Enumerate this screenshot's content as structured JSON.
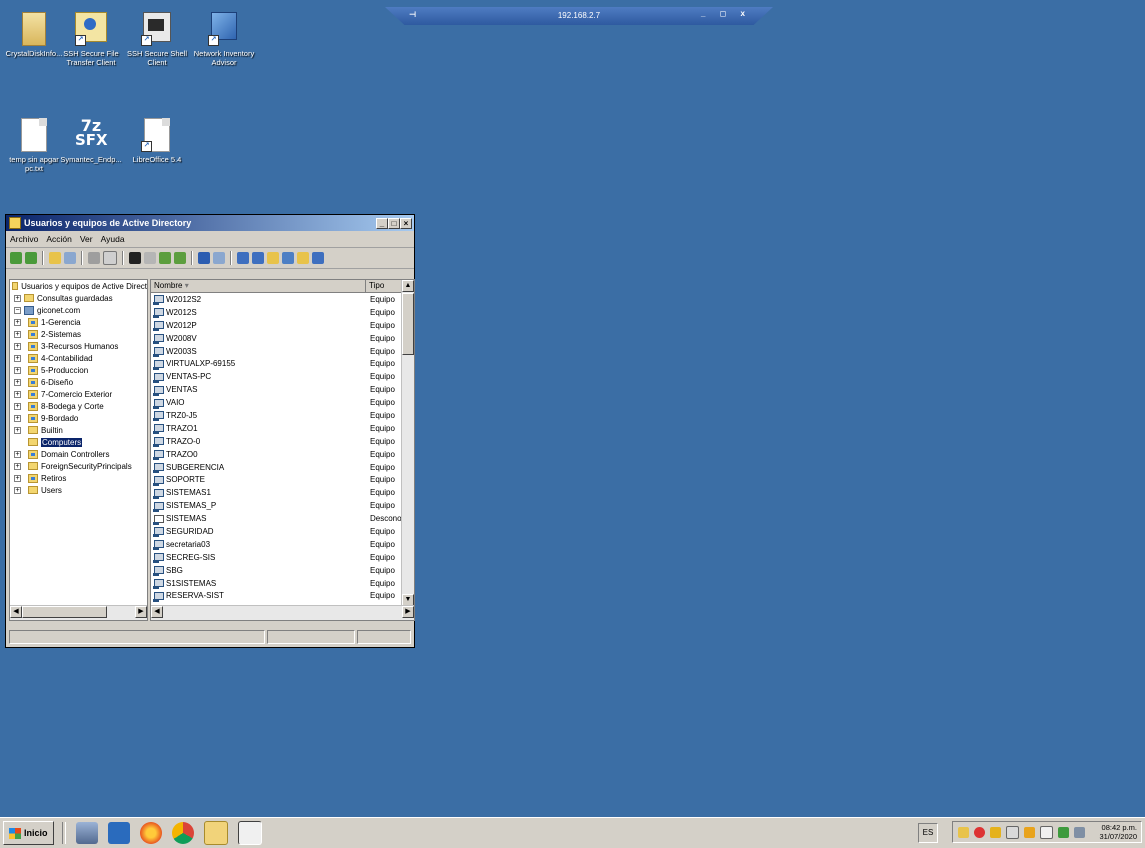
{
  "desktop": {
    "icons": [
      {
        "label": "CrystalDiskInfo..."
      },
      {
        "label": "SSH Secure File Transfer Client"
      },
      {
        "label": "SSH Secure Shell Client"
      },
      {
        "label": "Network Inventory Advisor"
      },
      {
        "label": "temp sin apgar pc.txt"
      },
      {
        "label": "Symantec_Endp..."
      },
      {
        "label": "LibreOffice 5.4"
      }
    ],
    "sfx_text": {
      "top": "7z",
      "bottom": "SFX"
    }
  },
  "rdp_bar": {
    "ip": "192.168.2.7",
    "pin": "⊣",
    "controls": "_ ◻ x"
  },
  "window": {
    "title": "Usuarios y equipos de Active Directory",
    "menu": [
      "Archivo",
      "Acción",
      "Ver",
      "Ayuda"
    ],
    "tree": {
      "root": "Usuarios y equipos de Active Direct",
      "saved_queries": "Consultas guardadas",
      "domain": "giconet.com",
      "children": [
        {
          "label": "1-Gerencia",
          "kind": "ou"
        },
        {
          "label": "2-Sistemas",
          "kind": "ou"
        },
        {
          "label": "3-Recursos Humanos",
          "kind": "ou"
        },
        {
          "label": "4-Contabilidad",
          "kind": "ou"
        },
        {
          "label": "5-Produccion",
          "kind": "ou"
        },
        {
          "label": "6-Diseño",
          "kind": "ou"
        },
        {
          "label": "7-Comercio Exterior",
          "kind": "ou"
        },
        {
          "label": "8-Bodega y Corte",
          "kind": "ou"
        },
        {
          "label": "9-Bordado",
          "kind": "ou"
        },
        {
          "label": "Builtin",
          "kind": "folder"
        },
        {
          "label": "Computers",
          "kind": "folder",
          "selected": true
        },
        {
          "label": "Domain Controllers",
          "kind": "ou"
        },
        {
          "label": "ForeignSecurityPrincipals",
          "kind": "folder"
        },
        {
          "label": "Retiros",
          "kind": "ou"
        },
        {
          "label": "Users",
          "kind": "folder"
        }
      ]
    },
    "list": {
      "col_name": "Nombre",
      "col_type": "Tipo",
      "rows": [
        {
          "name": "W2012S2",
          "type": "Equipo"
        },
        {
          "name": "W2012S",
          "type": "Equipo"
        },
        {
          "name": "W2012P",
          "type": "Equipo"
        },
        {
          "name": "W2008V",
          "type": "Equipo"
        },
        {
          "name": "W2003S",
          "type": "Equipo"
        },
        {
          "name": "VIRTUALXP-69155",
          "type": "Equipo"
        },
        {
          "name": "VENTAS-PC",
          "type": "Equipo"
        },
        {
          "name": "VENTAS",
          "type": "Equipo"
        },
        {
          "name": "VAIO",
          "type": "Equipo"
        },
        {
          "name": "TRZ0-J5",
          "type": "Equipo"
        },
        {
          "name": "TRAZO1",
          "type": "Equipo"
        },
        {
          "name": "TRAZO-0",
          "type": "Equipo"
        },
        {
          "name": "TRAZO0",
          "type": "Equipo"
        },
        {
          "name": "SUBGERENCIA",
          "type": "Equipo"
        },
        {
          "name": "SOPORTE",
          "type": "Equipo"
        },
        {
          "name": "SISTEMAS1",
          "type": "Equipo"
        },
        {
          "name": "SISTEMAS_P",
          "type": "Equipo"
        },
        {
          "name": "SISTEMAS",
          "type": "Desconoc"
        },
        {
          "name": "SEGURIDAD",
          "type": "Equipo"
        },
        {
          "name": "secretaria03",
          "type": "Equipo"
        },
        {
          "name": "SECREG-SIS",
          "type": "Equipo"
        },
        {
          "name": "SBG",
          "type": "Equipo"
        },
        {
          "name": "S1SISTEMAS",
          "type": "Equipo"
        },
        {
          "name": "RESERVA-SIST",
          "type": "Equipo"
        }
      ]
    }
  },
  "taskbar": {
    "start_label": "Inicio",
    "language": "ES",
    "time": "08:42 p.m.",
    "date": "31/07/2020"
  },
  "colors": {
    "desktop": "#3b6ea5",
    "title_active": "#0a246a",
    "selection": "#0a246a"
  }
}
